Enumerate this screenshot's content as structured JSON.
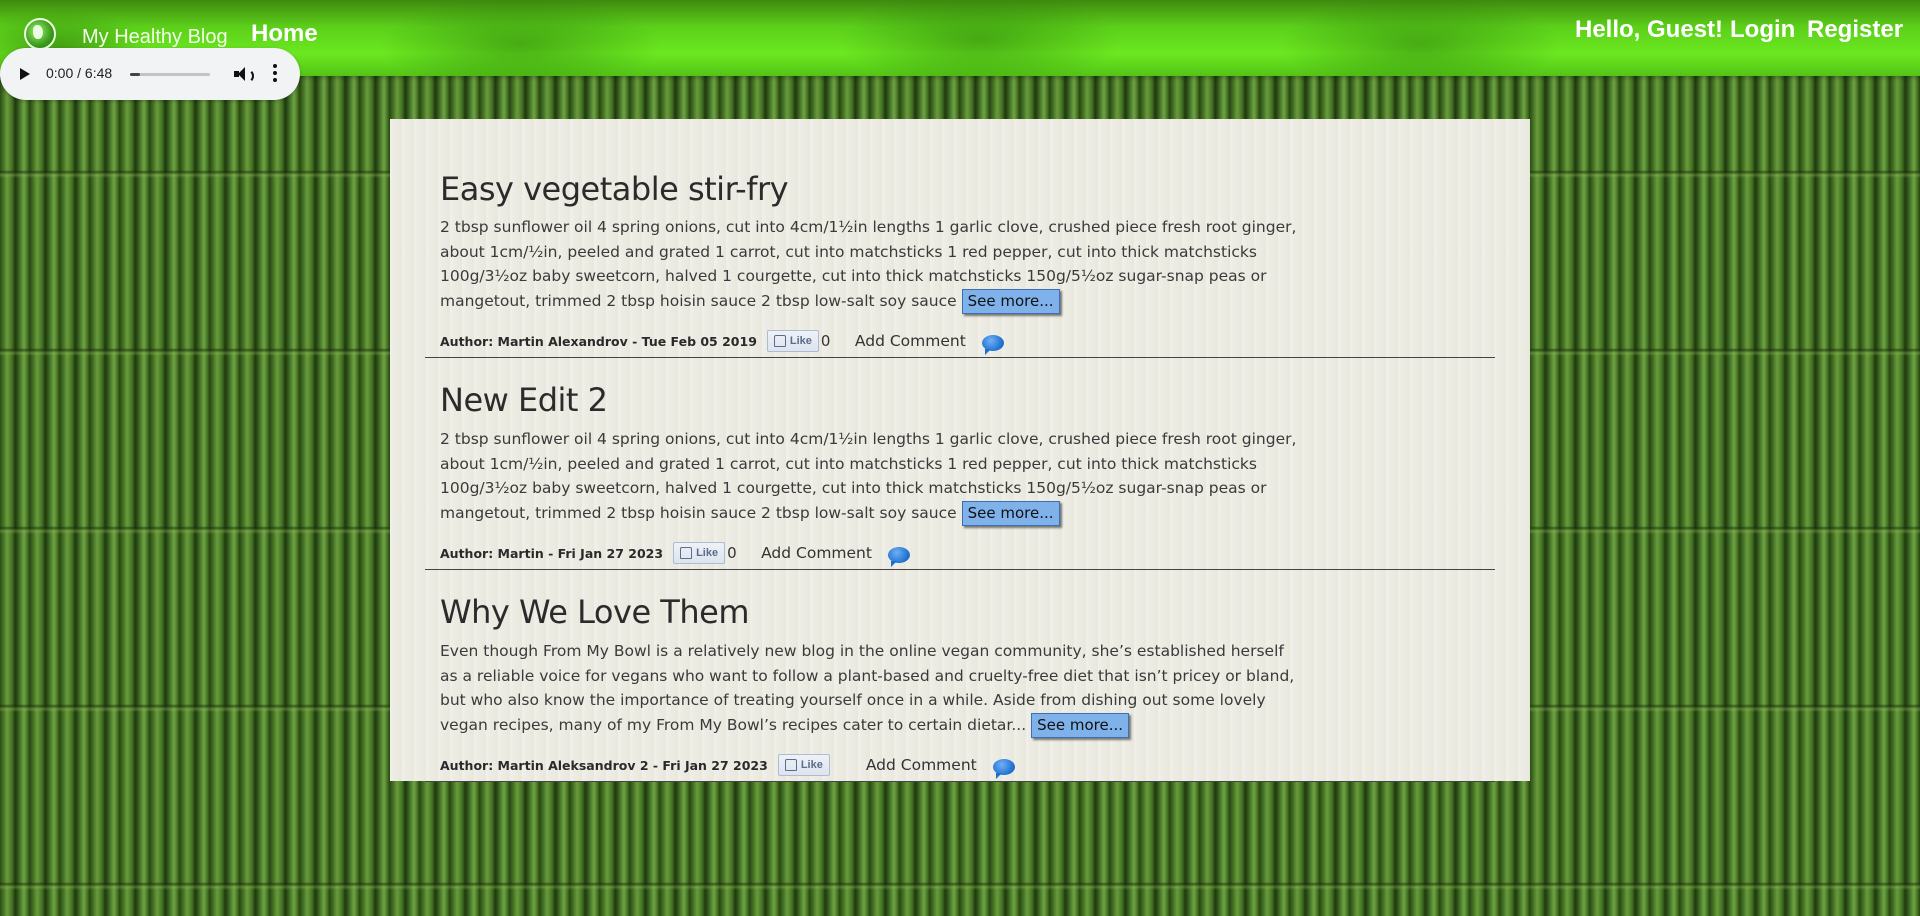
{
  "header": {
    "brand": "My Healthy Blog",
    "home": "Home",
    "greeting": "Hello, Guest!",
    "login": "Login",
    "register": "Register"
  },
  "audio": {
    "time": "0:00 / 6:48",
    "progress": 0.13
  },
  "posts": [
    {
      "title": "Easy vegetable stir-fry",
      "body": "2 tbsp sunflower oil 4 spring onions, cut into 4cm/1½in lengths 1 garlic clove, crushed piece fresh root ginger, about 1cm/½in, peeled and grated 1 carrot, cut into matchsticks 1 red pepper, cut into thick matchsticks 100g/3½oz baby sweetcorn, halved 1 courgette, cut into thick matchsticks 150g/5½oz sugar-snap peas or mangetout, trimmed 2 tbsp hoisin sauce 2 tbsp low-salt soy sauce",
      "see_more": "See more...",
      "author": "Author: Martin Alexandrov - Tue Feb 05 2019",
      "like": "Like",
      "likes": "0",
      "add_comment": "Add Comment"
    },
    {
      "title": "New Edit 2",
      "body": "2 tbsp sunflower oil 4 spring onions, cut into 4cm/1½in lengths 1 garlic clove, crushed piece fresh root ginger, about 1cm/½in, peeled and grated 1 carrot, cut into matchsticks 1 red pepper, cut into thick matchsticks 100g/3½oz baby sweetcorn, halved 1 courgette, cut into thick matchsticks 150g/5½oz sugar-snap peas or mangetout, trimmed 2 tbsp hoisin sauce 2 tbsp low-salt soy sauce",
      "see_more": "See more...",
      "author": "Author: Martin - Fri Jan 27 2023",
      "like": "Like",
      "likes": "0",
      "add_comment": "Add Comment"
    },
    {
      "title": "Why We Love Them",
      "body": "Even though From My Bowl is a relatively new blog in the online vegan community, she’s established herself as a reliable voice for vegans who want to follow a plant-based and cruelty-free diet that isn’t pricey or bland, but who also know the importance of treating yourself once in a while. Aside from dishing out some lovely vegan recipes, many of my From My Bowl’s recipes cater to certain dietar...",
      "see_more": "See more...",
      "author": "Author: Martin Aleksandrov 2 - Fri Jan 27 2023",
      "like": "Like",
      "likes": "",
      "add_comment": "Add Comment"
    }
  ]
}
